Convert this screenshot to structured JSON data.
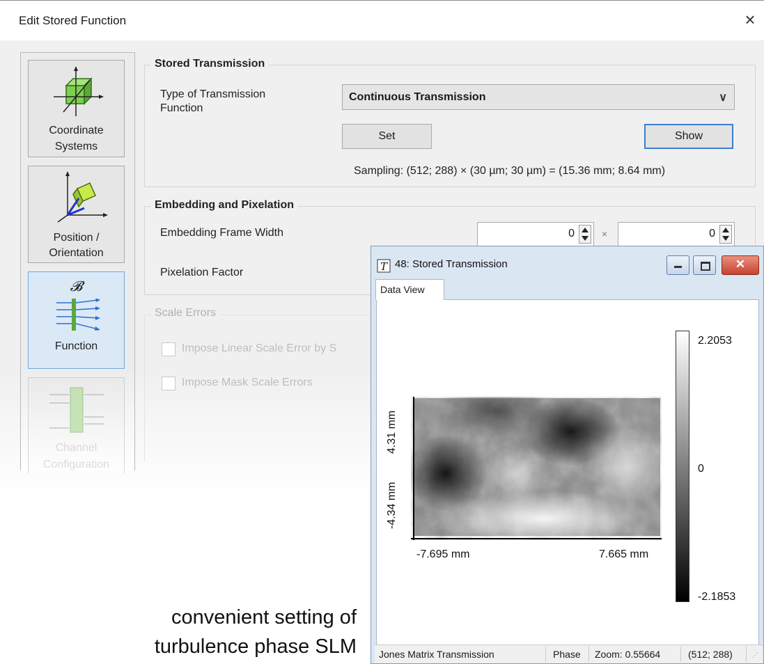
{
  "dialog": {
    "title": "Edit Stored Function",
    "close_glyph": "×"
  },
  "sidebar": {
    "items": [
      {
        "id": "coordinate-systems",
        "line1": "Coordinate",
        "line2": "Systems",
        "state": "normal"
      },
      {
        "id": "position-orientation",
        "line1": "Position /",
        "line2": "Orientation",
        "state": "normal"
      },
      {
        "id": "function",
        "line1": "Function",
        "line2": "",
        "state": "selected",
        "glyph": "𝓑"
      },
      {
        "id": "channel-configuration",
        "line1": "Channel",
        "line2": "Configuration",
        "state": "disabled"
      }
    ]
  },
  "stored_transmission": {
    "group_title": "Stored Transmission",
    "type_label": "Type of Transmission Function",
    "type_label_line1": "Type of Transmission",
    "type_label_line2": "Function",
    "type_value": "Continuous Transmission",
    "set_label": "Set",
    "show_label": "Show",
    "sampling": "Sampling: (512; 288) × (30 µm; 30 µm) = (15.36 mm; 8.64 mm)"
  },
  "embedding": {
    "group_title": "Embedding and Pixelation",
    "frame_width_label": "Embedding Frame Width",
    "frame_width_x": "0",
    "frame_width_y": "0",
    "times_glyph": "×",
    "pixelation_label": "Pixelation Factor"
  },
  "scale_errors": {
    "group_title": "Scale Errors",
    "linear_label": "Impose Linear Scale Error by S",
    "mask_label": "Impose Mask Scale Errors"
  },
  "caption": {
    "line1": "convenient setting of",
    "line2": "turbulence phase SLM"
  },
  "child_window": {
    "title": "48: Stored Transmission",
    "tab": "Data View",
    "x_min": "-7.695 mm",
    "x_max": "7.665 mm",
    "y_top": "4.31 mm",
    "y_bottom": "-4.34 mm",
    "colorbar_max": "2.2053",
    "colorbar_mid": "0",
    "colorbar_min": "-2.1853",
    "status": {
      "mode": "Jones Matrix Transmission",
      "component": "Phase",
      "zoom": "Zoom: 0.55664",
      "size": "(512; 288)"
    }
  },
  "colors": {
    "selected_bg": "#dbe9f7",
    "selected_border": "#6fa9dc",
    "focus_border": "#3a7fd0",
    "close_red": "#c9432f"
  }
}
